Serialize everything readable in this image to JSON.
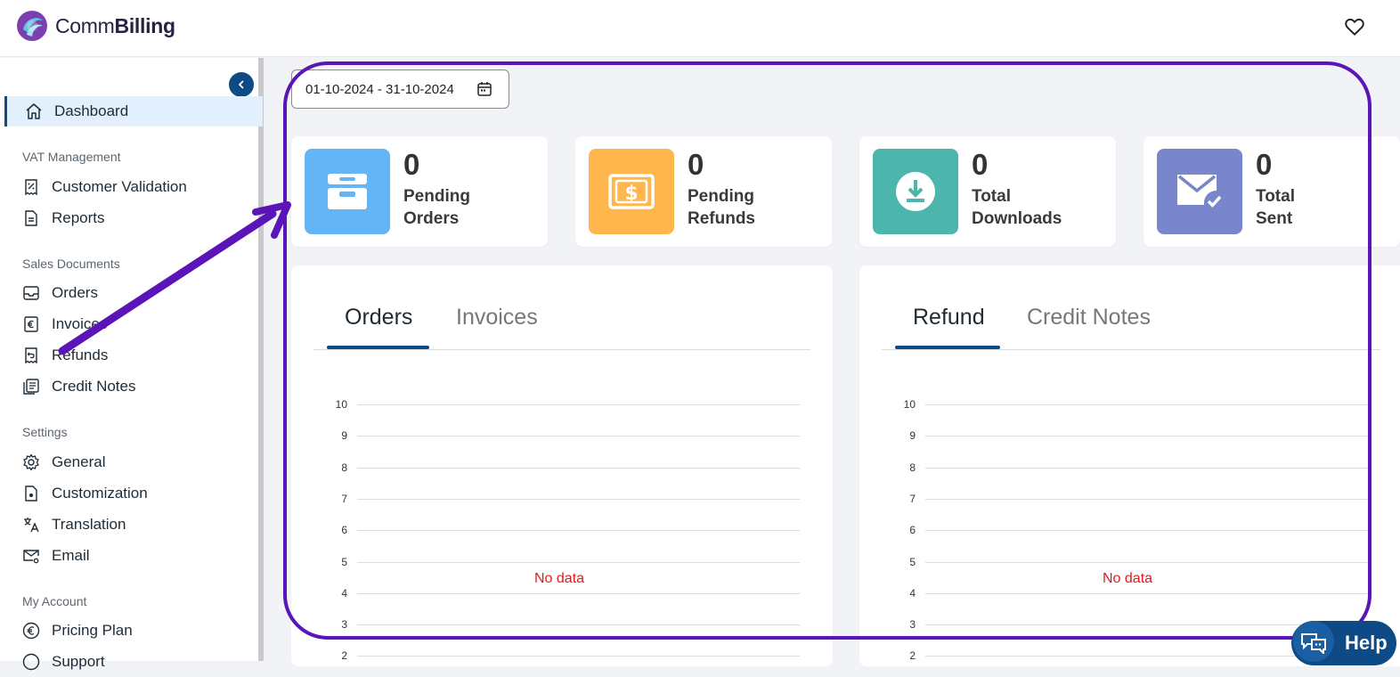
{
  "app": {
    "logo_text_light": "Comm",
    "logo_text_bold": "Billing"
  },
  "sidebar": {
    "dashboard": "Dashboard",
    "sections": {
      "vat": "VAT Management",
      "sales": "Sales Documents",
      "settings": "Settings",
      "account": "My Account"
    },
    "items": {
      "customer_validation": "Customer Validation",
      "reports": "Reports",
      "orders": "Orders",
      "invoices": "Invoices",
      "refunds": "Refunds",
      "credit_notes": "Credit Notes",
      "general": "General",
      "customization": "Customization",
      "translation": "Translation",
      "email": "Email",
      "pricing_plan": "Pricing Plan",
      "support": "Support"
    }
  },
  "main": {
    "date_range": "01-10-2024 - 31-10-2024",
    "stats": [
      {
        "value": "0",
        "line1": "Pending",
        "line2": "Orders",
        "color": "#64b5f6",
        "icon": "inbox-tray-icon"
      },
      {
        "value": "0",
        "line1": "Pending",
        "line2": "Refunds",
        "color": "#ffb74d",
        "icon": "money-bill-icon"
      },
      {
        "value": "0",
        "line1": "Total",
        "line2": "Downloads",
        "color": "#4db6ac",
        "icon": "download-icon"
      },
      {
        "value": "0",
        "line1": "Total",
        "line2": "Sent",
        "color": "#7986cb",
        "icon": "mail-check-icon"
      }
    ],
    "left_panel": {
      "tab_active": "Orders",
      "tab_other": "Invoices",
      "no_data": "No data"
    },
    "right_panel": {
      "tab_active": "Refund",
      "tab_other": "Credit Notes",
      "no_data": "No data"
    },
    "y_ticks": [
      "10",
      "9",
      "8",
      "7",
      "6",
      "5",
      "4",
      "3",
      "2"
    ]
  },
  "help": {
    "label": "Help"
  },
  "colors": {
    "accent": "#0d4a86",
    "annotation": "#5b14b8",
    "no_data": "#e01b1b"
  }
}
